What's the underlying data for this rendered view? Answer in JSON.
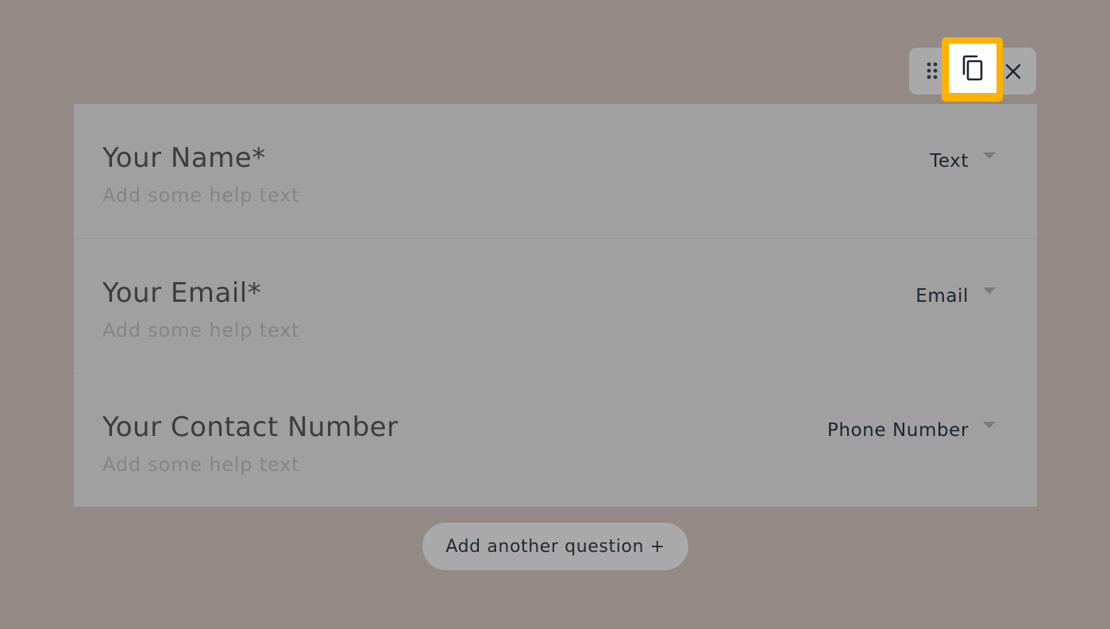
{
  "toolbar": {
    "drag_icon": "drag-handle-icon",
    "copy_icon": "copy-icon",
    "close_icon": "close-icon"
  },
  "questions": [
    {
      "title": "Your Name*",
      "help": "Add some help text",
      "type": "Text"
    },
    {
      "title": "Your Email*",
      "help": "Add some help text",
      "type": "Email"
    },
    {
      "title": "Your Contact Number",
      "help": "Add some help text",
      "type": "Phone Number"
    }
  ],
  "add_question_label": "Add another question +",
  "colors": {
    "overlay_background": "#948a85",
    "highlight": "#fdb100",
    "card": "#a0a0a0"
  }
}
